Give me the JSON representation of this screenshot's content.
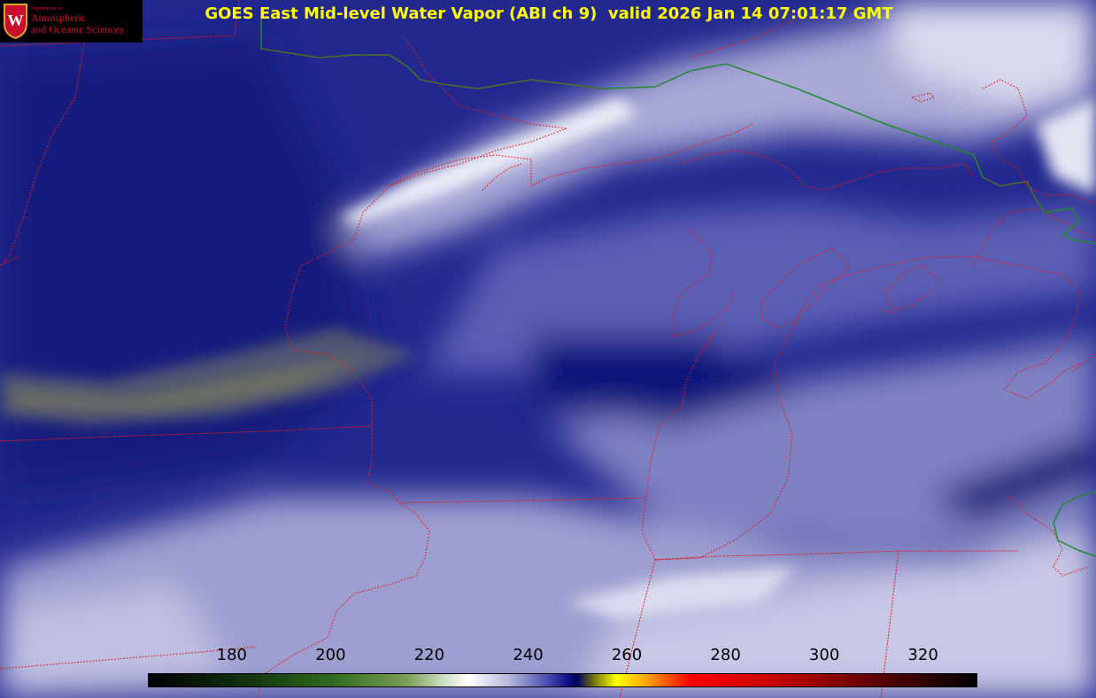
{
  "title": "GOES East Mid-level Water Vapor (ABI ch 9)  valid 2026 Jan 14 07:01:17 GMT",
  "logo": {
    "line1": "Department of",
    "line2": "Atmospheric",
    "line3": "and Oceanic Sciences",
    "seal_letter": "W",
    "icon": "uw-crest-icon"
  },
  "colorbar": {
    "unit": "",
    "ticks": [
      "180",
      "200",
      "220",
      "240",
      "260",
      "280",
      "300",
      "320"
    ],
    "range_min": 163,
    "range_max": 331,
    "gradient": [
      {
        "v": 163,
        "c": "#000000"
      },
      {
        "v": 180,
        "c": "#0f2a0c"
      },
      {
        "v": 200,
        "c": "#2d6a1e"
      },
      {
        "v": 215,
        "c": "#7a9c55"
      },
      {
        "v": 224,
        "c": "#d8e8d0"
      },
      {
        "v": 228,
        "c": "#ffffff"
      },
      {
        "v": 236,
        "c": "#b8b8dd"
      },
      {
        "v": 244,
        "c": "#4c4cb0"
      },
      {
        "v": 248,
        "c": "#10108a"
      },
      {
        "v": 250,
        "c": "#000060"
      },
      {
        "v": 254,
        "c": "#8a8a00"
      },
      {
        "v": 258,
        "c": "#ffff00"
      },
      {
        "v": 264,
        "c": "#ffa500"
      },
      {
        "v": 273,
        "c": "#ff0000"
      },
      {
        "v": 290,
        "c": "#c80000"
      },
      {
        "v": 310,
        "c": "#600000"
      },
      {
        "v": 331,
        "c": "#000000"
      }
    ]
  },
  "colors": {
    "border_state": "#e41a1a",
    "border_international": "#1f8a2e",
    "background": "#1b1f86"
  }
}
